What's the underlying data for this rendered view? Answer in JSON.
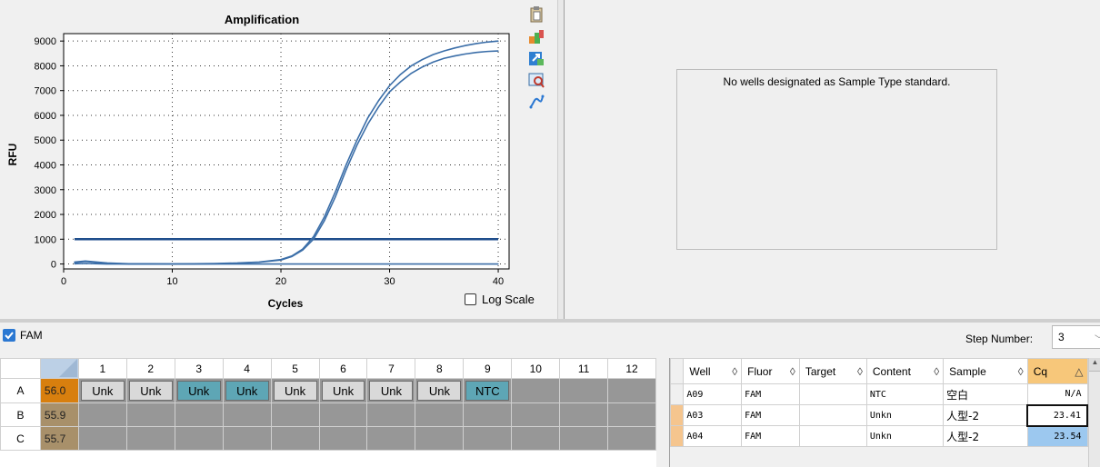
{
  "chart": {
    "title": "Amplification",
    "ylabel": "RFU",
    "xlabel": "Cycles",
    "log_scale_label": "Log Scale",
    "log_scale_checked": false
  },
  "chart_data": {
    "type": "line",
    "title": "Amplification",
    "xlabel": "Cycles",
    "ylabel": "RFU",
    "xlim": [
      0,
      41
    ],
    "ylim": [
      -200,
      9300
    ],
    "xticks": [
      0,
      10,
      20,
      30,
      40
    ],
    "yticks": [
      0,
      1000,
      2000,
      3000,
      4000,
      5000,
      6000,
      7000,
      8000,
      9000
    ],
    "grid": "dotted",
    "threshold": 1000,
    "series": [
      {
        "x": [
          1,
          2,
          4,
          6,
          8,
          10,
          12,
          14,
          16,
          18,
          20,
          21,
          22,
          23,
          24,
          25,
          26,
          27,
          28,
          29,
          30,
          31,
          32,
          33,
          34,
          35,
          36,
          37,
          38,
          39,
          40
        ],
        "values": [
          80,
          120,
          40,
          10,
          10,
          0,
          10,
          20,
          40,
          80,
          180,
          320,
          600,
          1100,
          1900,
          2900,
          4000,
          5000,
          5900,
          6600,
          7200,
          7650,
          8000,
          8250,
          8450,
          8600,
          8720,
          8820,
          8900,
          8960,
          9000
        ]
      },
      {
        "x": [
          1,
          2,
          4,
          6,
          8,
          10,
          12,
          14,
          16,
          18,
          20,
          21,
          22,
          23,
          24,
          25,
          26,
          27,
          28,
          29,
          30,
          31,
          32,
          33,
          34,
          35,
          36,
          37,
          38,
          39,
          40
        ],
        "values": [
          60,
          100,
          30,
          0,
          0,
          0,
          0,
          10,
          30,
          70,
          160,
          300,
          560,
          1000,
          1750,
          2700,
          3800,
          4800,
          5650,
          6350,
          6950,
          7350,
          7700,
          7950,
          8150,
          8300,
          8400,
          8480,
          8540,
          8580,
          8600
        ]
      },
      {
        "x": [
          1,
          2,
          4,
          6,
          8,
          10,
          20,
          30,
          40
        ],
        "values": [
          10,
          20,
          0,
          0,
          0,
          0,
          0,
          0,
          0
        ]
      }
    ]
  },
  "standard_curve": {
    "message": "No wells designated as Sample Type standard."
  },
  "fluor": {
    "label": "FAM",
    "checked": true
  },
  "step": {
    "label": "Step Number:",
    "value": "3"
  },
  "plate": {
    "columns": [
      "1",
      "2",
      "3",
      "4",
      "5",
      "6",
      "7",
      "8",
      "9",
      "10",
      "11",
      "12"
    ],
    "rows": [
      {
        "label": "A",
        "temp": "56.0",
        "wells": [
          "Unk",
          "Unk",
          "Unk",
          "Unk",
          "Unk",
          "Unk",
          "Unk",
          "Unk",
          "NTC",
          "",
          "",
          ""
        ],
        "teal": [
          false,
          false,
          true,
          true,
          false,
          false,
          false,
          false,
          true,
          false,
          false,
          false
        ]
      },
      {
        "label": "B",
        "temp": "55.9",
        "wells": [
          "",
          "",
          "",
          "",
          "",
          "",
          "",
          "",
          "",
          "",
          "",
          ""
        ],
        "teal": [
          false,
          false,
          false,
          false,
          false,
          false,
          false,
          false,
          false,
          false,
          false,
          false
        ]
      },
      {
        "label": "C",
        "temp": "55.7",
        "wells": [
          "",
          "",
          "",
          "",
          "",
          "",
          "",
          "",
          "",
          "",
          "",
          ""
        ],
        "teal": [
          false,
          false,
          false,
          false,
          false,
          false,
          false,
          false,
          false,
          false,
          false,
          false
        ]
      }
    ]
  },
  "results": {
    "headers": [
      "Well",
      "Fluor",
      "Target",
      "Content",
      "Sample",
      "Cq"
    ],
    "sort_glyph": "◊",
    "cq_sort_glyph": "△",
    "rows": [
      {
        "well": "A09",
        "fluor": "FAM",
        "target": "",
        "content": "NTC",
        "sample": "空白",
        "cq": "N/A"
      },
      {
        "well": "A03",
        "fluor": "FAM",
        "target": "",
        "content": "Unkn",
        "sample": "人型-2",
        "cq": "23.41"
      },
      {
        "well": "A04",
        "fluor": "FAM",
        "target": "",
        "content": "Unkn",
        "sample": "人型-2",
        "cq": "23.54"
      }
    ]
  },
  "icons": [
    "clipboard-icon",
    "chart-settings-icon",
    "export-icon",
    "zoom-icon",
    "curve-icon"
  ]
}
